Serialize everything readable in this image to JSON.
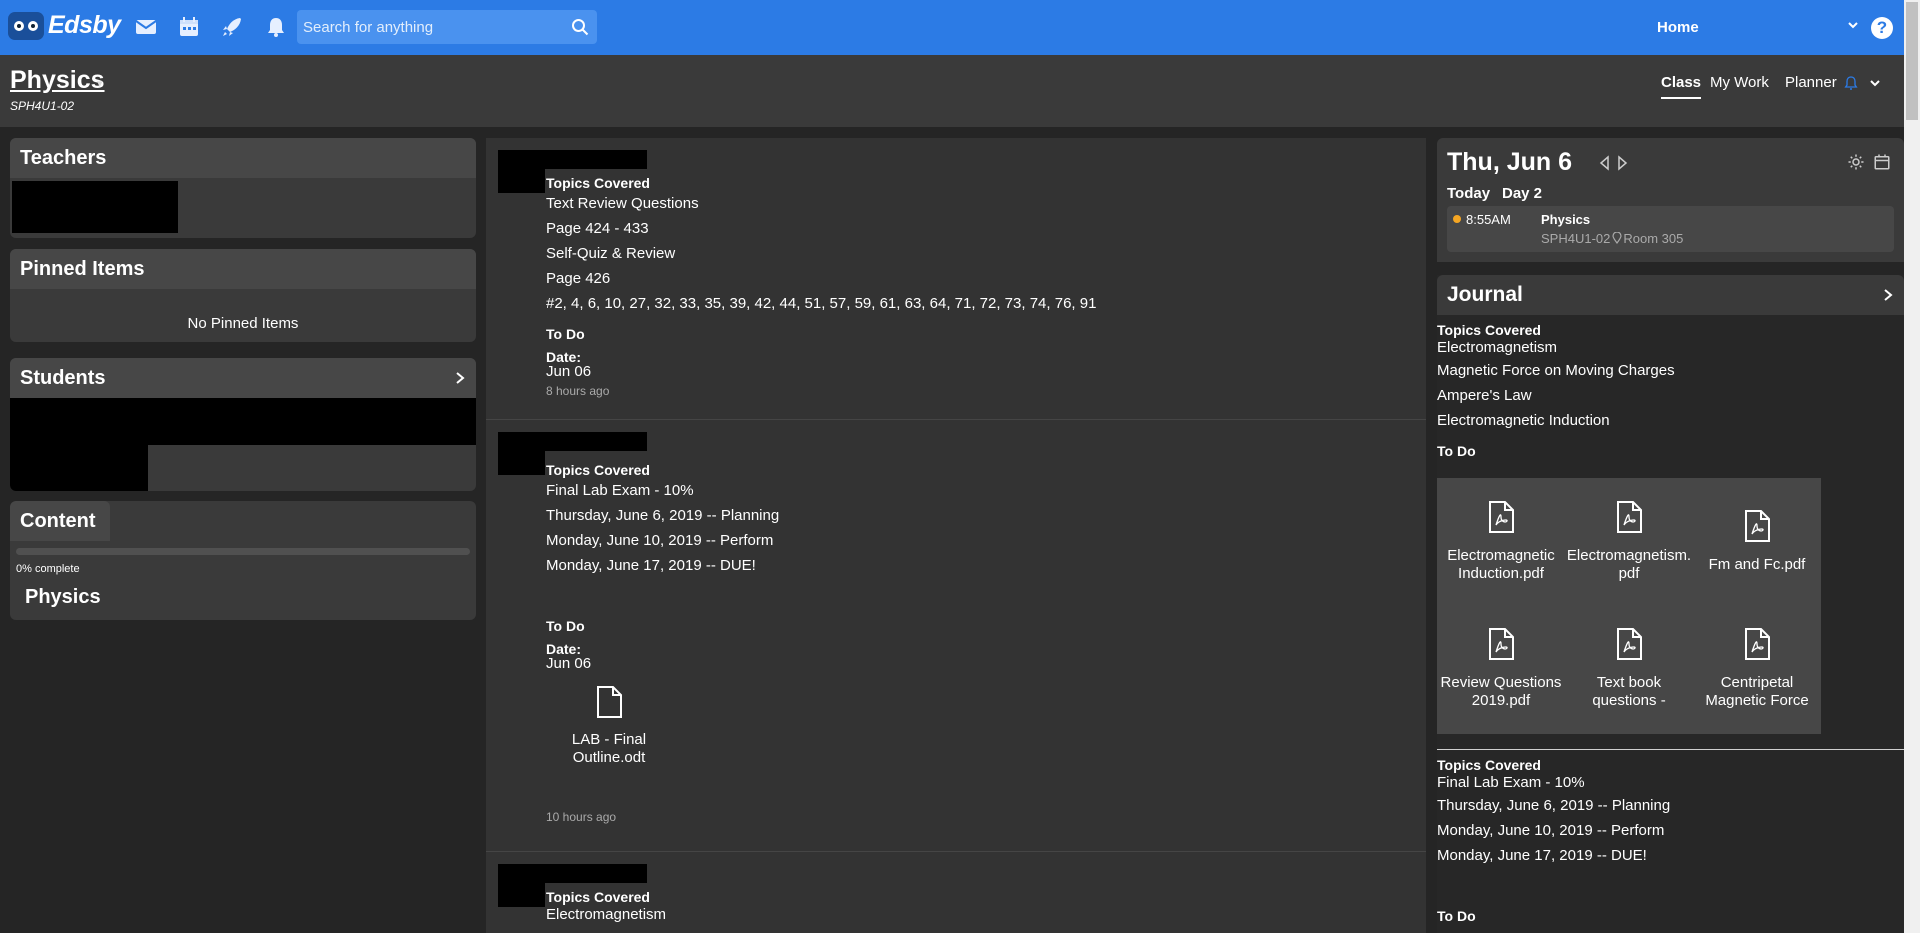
{
  "topbar": {
    "logo_text": "Edsby",
    "nav_icons": [
      "mail-icon",
      "calendar-icon",
      "rocket-icon",
      "bell-icon"
    ],
    "search_placeholder": "Search for anything",
    "home_label": "Home",
    "help_glyph": "?",
    "color": "#2c7be5"
  },
  "class_header": {
    "title": "Physics",
    "code": "SPH4U1-02",
    "tabs": [
      {
        "label": "Class",
        "active": true
      },
      {
        "label": "My Work",
        "active": false
      },
      {
        "label": "Planner",
        "active": false
      }
    ]
  },
  "left": {
    "teachers_title": "Teachers",
    "pinned_title": "Pinned Items",
    "pinned_empty": "No Pinned Items",
    "students_title": "Students",
    "content_title": "Content",
    "progress_label": "0% complete",
    "progress_value": 0,
    "content_item": "Physics"
  },
  "feed": {
    "posts": [
      {
        "heading": "Topics Covered",
        "lines": [
          "Text Review Questions",
          "Page 424 - 433",
          "Self-Quiz & Review",
          "Page 426",
          "#2, 4, 6, 10, 27, 32, 33, 35, 39, 42, 44, 51, 57, 59, 61, 63, 64, 71, 72, 73, 74, 76, 91"
        ],
        "todo": "To Do",
        "date_label": "Date:",
        "date": "Jun 06",
        "ago": "8 hours ago"
      },
      {
        "heading": "Topics Covered",
        "lines": [
          "Final Lab Exam - 10%",
          "Thursday, June 6, 2019 -- Planning",
          "Monday, June 10, 2019 -- Perform",
          "Monday, June 17, 2019 -- DUE!"
        ],
        "todo": "To Do",
        "date_label": "Date:",
        "date": "Jun 06",
        "attachment_line1": "LAB - Final",
        "attachment_line2": "Outline.odt",
        "ago": "10 hours ago"
      },
      {
        "heading": "Topics Covered",
        "lines": [
          "Electromagnetism"
        ]
      }
    ]
  },
  "calendar": {
    "date": "Thu, Jun 6",
    "today": "Today",
    "day": "Day 2",
    "event_time": "8:55AM",
    "event_course": "Physics",
    "event_room": "SPH4U1-02",
    "event_location": "Room 305",
    "dot_color": "#f5a623"
  },
  "journal": {
    "title": "Journal",
    "entry1": {
      "heading": "Topics Covered",
      "lines": [
        "Electromagnetism",
        "Magnetic Force on Moving Charges",
        "Ampere's Law",
        "Electromagnetic Induction"
      ],
      "todo": "To Do"
    },
    "files": [
      {
        "line1": "Electromagnetic",
        "line2": "Induction.pdf"
      },
      {
        "line1": "Electromagnetism.",
        "line2": "pdf"
      },
      {
        "line1": "Fm and Fc.pdf",
        "line2": ""
      },
      {
        "line1": "Review Questions",
        "line2": "2019.pdf"
      },
      {
        "line1": "Text book",
        "line2": "questions -"
      },
      {
        "line1": "Centripetal",
        "line2": "Magnetic Force"
      }
    ],
    "entry2": {
      "heading": "Topics Covered",
      "lines": [
        "Final Lab Exam - 10%",
        "Thursday, June 6, 2019 -- Planning",
        "Monday, June 10, 2019 -- Perform",
        "Monday, June 17, 2019 -- DUE!"
      ],
      "todo": "To Do"
    }
  }
}
